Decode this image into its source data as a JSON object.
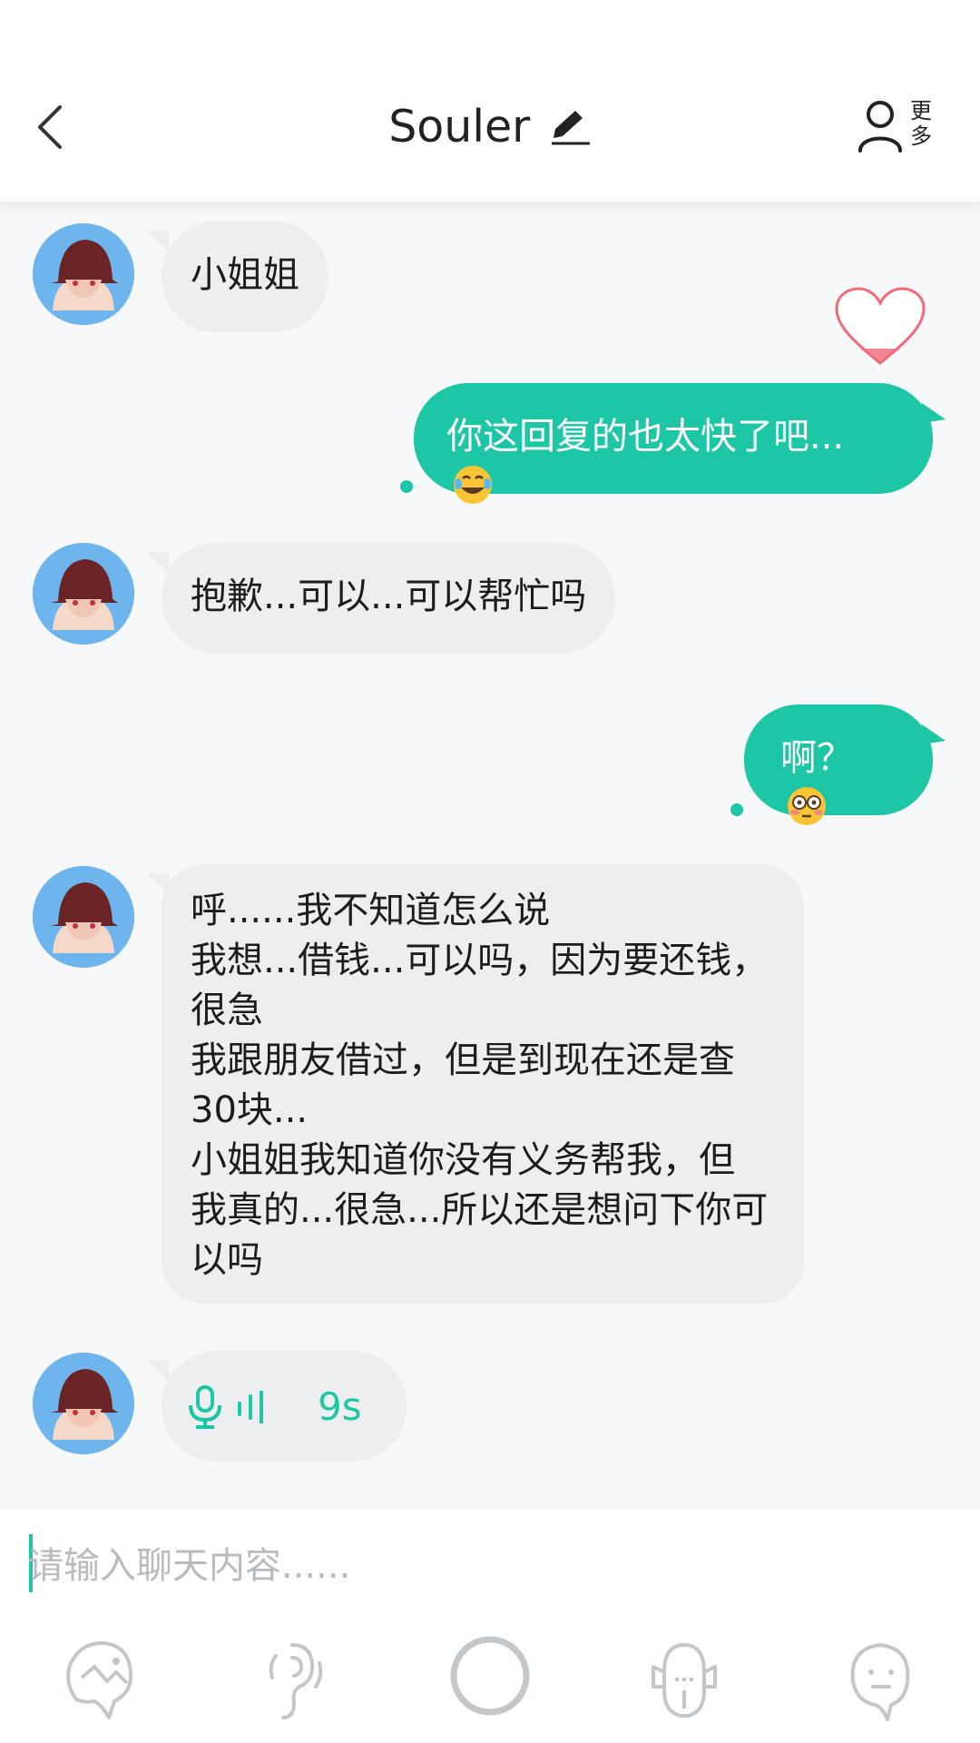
{
  "header": {
    "title": "Souler",
    "more_label_line1": "更",
    "more_label_line2": "多"
  },
  "messages": [
    {
      "side": "left",
      "type": "text",
      "text": "小姐姐"
    },
    {
      "side": "right",
      "type": "text",
      "text": "你这回复的也太快了吧...",
      "emoji": "laughing-tears"
    },
    {
      "side": "left",
      "type": "text",
      "text": "抱歉...可以...可以帮忙吗"
    },
    {
      "side": "right",
      "type": "text",
      "text": "啊？",
      "emoji": "flushed"
    },
    {
      "side": "left",
      "type": "text",
      "lines": [
        "呼......我不知道怎么说",
        "我想...借钱...可以吗，因为要还钱，",
        "很急",
        "我跟朋友借过，但是到现在还是查",
        "30块...",
        "小姐姐我知道你没有义务帮我，但",
        "我真的...很急...所以还是想问下你可",
        "以吗"
      ]
    },
    {
      "side": "left",
      "type": "voice",
      "duration": "9s"
    }
  ],
  "input": {
    "placeholder": "请输入聊天内容......"
  },
  "toolbar": {
    "icons": [
      "face-icon",
      "gesture-icon",
      "circle-button-icon",
      "mask-icon",
      "avatar-face-icon"
    ]
  },
  "colors": {
    "accent": "#1dc6a4",
    "bubble_left": "#eceef0",
    "heart": "#f06a7a"
  }
}
